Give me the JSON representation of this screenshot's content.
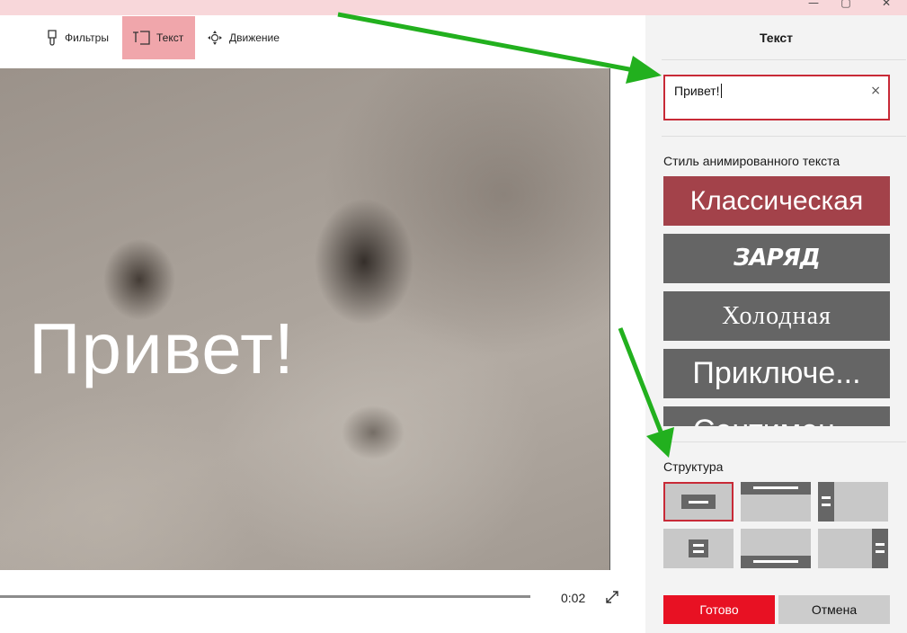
{
  "window": {
    "minimize_icon": "—",
    "maximize_icon": "▢",
    "close_icon": "✕"
  },
  "toolbar": {
    "filters_label": "Фильтры",
    "text_label": "Текст",
    "motion_label": "Движение",
    "filters_icon": "brush-icon",
    "text_icon": "text-box-icon",
    "motion_icon": "motion-icon",
    "active_color": "#f0a6ab"
  },
  "preview": {
    "overlay_text": "Привет!"
  },
  "playback": {
    "time": "0:02",
    "fullscreen_icon": "expand-icon"
  },
  "panel": {
    "title": "Текст",
    "text_input": {
      "value": "Привет!",
      "clear_icon": "×"
    },
    "styles_label": "Стиль анимированного текста",
    "styles": [
      {
        "label": "Классическая",
        "selected": true
      },
      {
        "label": "ЗАРЯД",
        "selected": false
      },
      {
        "label": "Холодная",
        "selected": false
      },
      {
        "label": "Приключе...",
        "selected": false
      },
      {
        "label": "Сентимен...",
        "selected": false
      }
    ],
    "layout_label": "Структура",
    "layouts": [
      {
        "name": "center",
        "selected": true
      },
      {
        "name": "top",
        "selected": false
      },
      {
        "name": "left",
        "selected": false
      },
      {
        "name": "small-center",
        "selected": false
      },
      {
        "name": "bottom",
        "selected": false
      },
      {
        "name": "right",
        "selected": false
      }
    ],
    "done_label": "Готово",
    "cancel_label": "Отмена",
    "accent_color": "#e81123",
    "selected_border_color": "#c82a37"
  },
  "annotation": {
    "arrow_color": "#22b01e"
  }
}
